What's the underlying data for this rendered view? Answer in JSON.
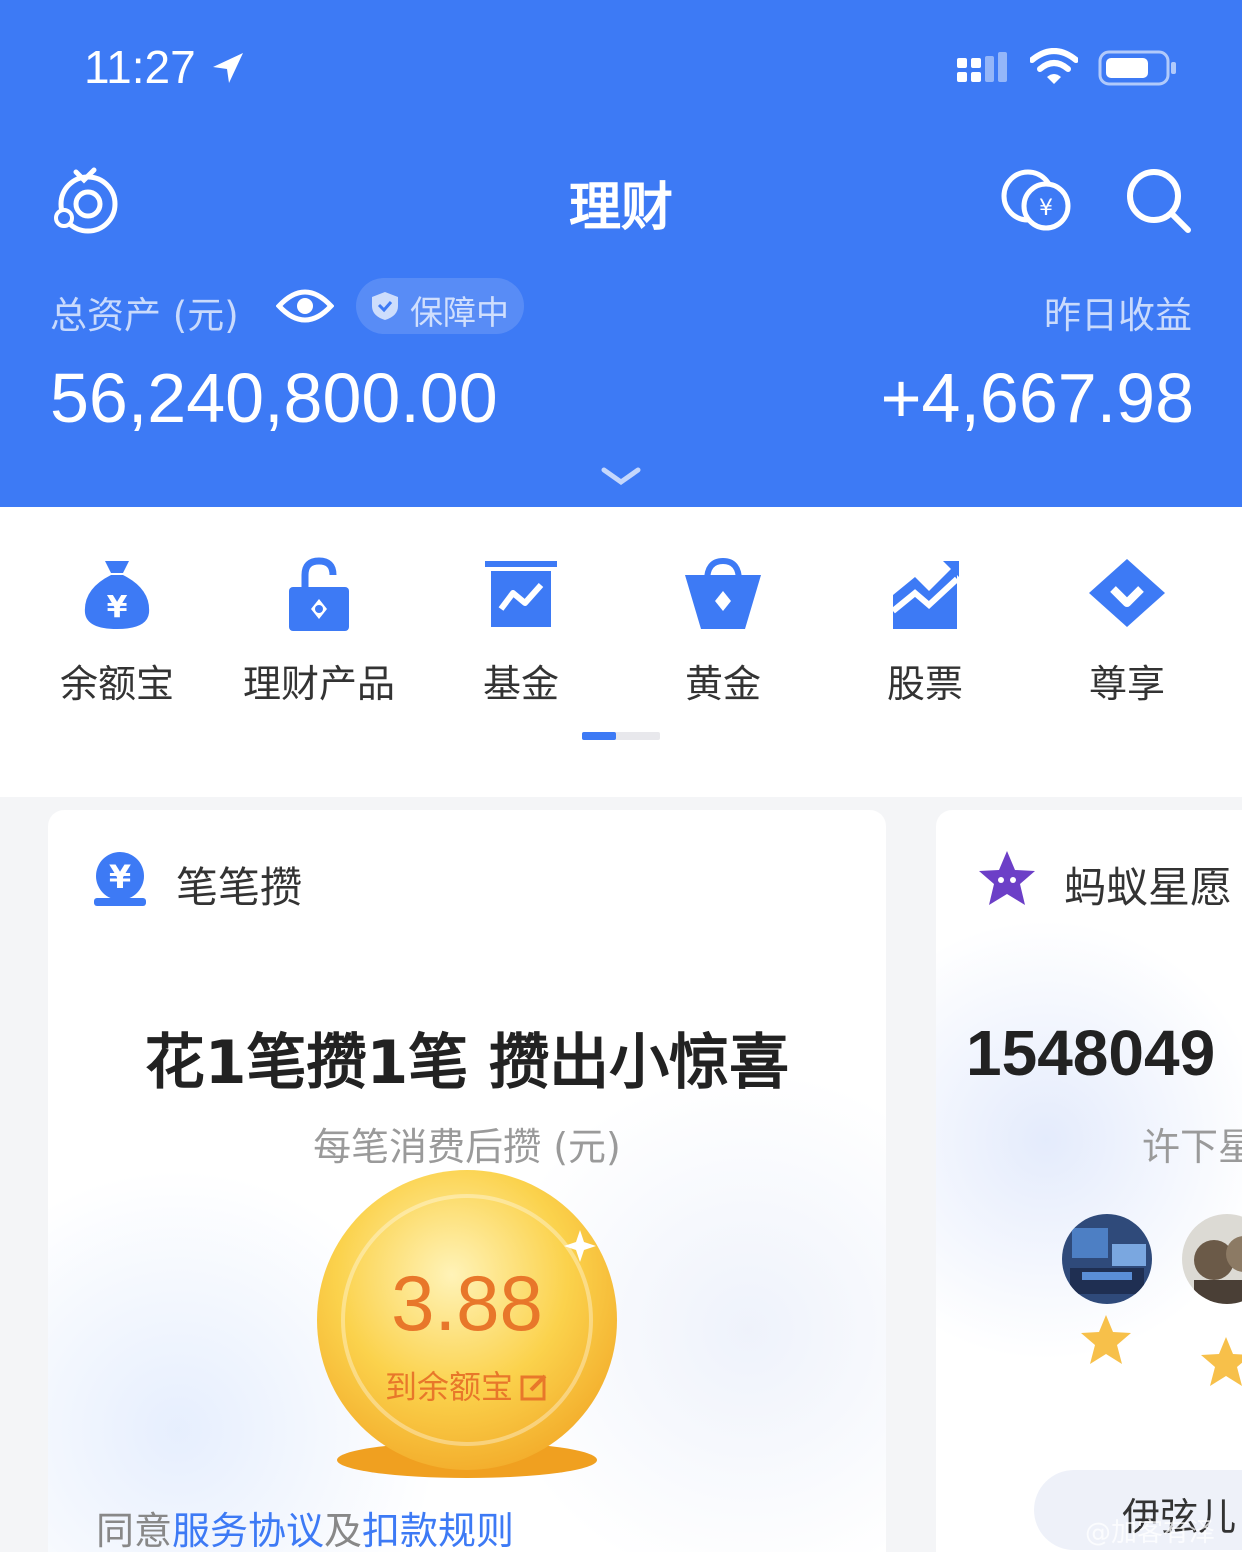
{
  "status_bar": {
    "time": "11:27"
  },
  "header": {
    "title": "理财",
    "total_assets_label": "总资产 (元)",
    "protection_badge": "保障中",
    "total_assets_value": "56,240,800.00",
    "yesterday_label": "昨日收益",
    "yesterday_value": "+4,667.98"
  },
  "categories": [
    {
      "label": "余额宝",
      "icon": "money-bag-icon"
    },
    {
      "label": "理财产品",
      "icon": "lock-icon"
    },
    {
      "label": "基金",
      "icon": "chart-icon"
    },
    {
      "label": "黄金",
      "icon": "gold-basket-icon"
    },
    {
      "label": "股票",
      "icon": "stock-icon"
    },
    {
      "label": "尊享",
      "icon": "diamond-icon"
    }
  ],
  "card_savings": {
    "title": "笔笔攒",
    "headline": "花1笔攒1笔 攒出小惊喜",
    "subtitle": "每笔消费后攒 (元)",
    "amount": "3.88",
    "amount_caption": "到余额宝",
    "agree_prefix": "同意",
    "agree_link1": "服务协议",
    "agree_mid": "及",
    "agree_link2": "扣款规则"
  },
  "card_wish": {
    "title": "蚂蚁星愿",
    "number": "1548049",
    "subtitle": "许下星",
    "user_name": "伊弦儿"
  },
  "watermark": "@加客有泽",
  "colors": {
    "brand_blue": "#3d7af5",
    "coin_orange": "#e8772a"
  }
}
